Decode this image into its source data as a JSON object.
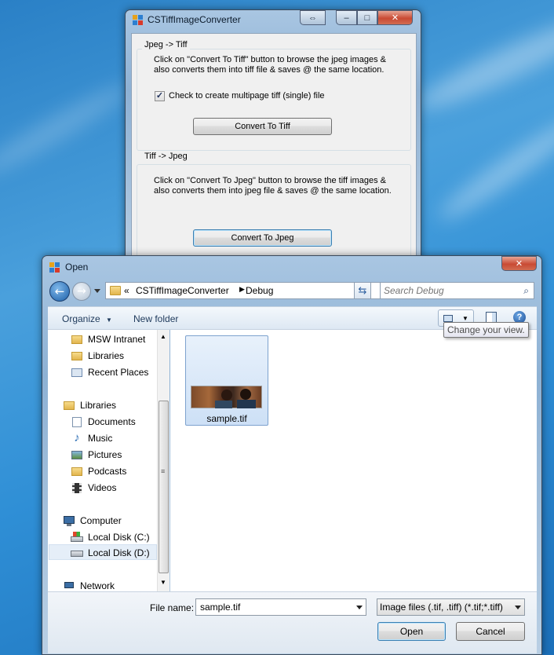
{
  "converter": {
    "title": "CSTiffImageConverter",
    "group1": {
      "label": "Jpeg -> Tiff",
      "desc_line1": "Click on \"Convert To Tiff\" button to browse the jpeg images &",
      "desc_line2": "also converts them into tiff file & saves @ the same location.",
      "checkbox_label": "Check to create multipage tiff (single) file",
      "checkbox_checked": true,
      "button": "Convert To Tiff"
    },
    "group2": {
      "label": "Tiff -> Jpeg",
      "desc_line1": "Click on \"Convert To Jpeg\" button to browse the tiff images &",
      "desc_line2": "also converts them into jpeg file & saves @ the same location.",
      "button": "Convert To Jpeg"
    },
    "title_buttons": {
      "swap": "⇔",
      "minimize": "–",
      "maximize": "□",
      "close": "✕"
    }
  },
  "open_dialog": {
    "title": "Open",
    "breadcrumb": {
      "overflow": "«",
      "items": [
        "CSTiffImageConverter",
        "Debug"
      ]
    },
    "search_placeholder": "Search Debug",
    "toolbar": {
      "organize": "Organize",
      "new_folder": "New folder"
    },
    "tooltip": "Change your view.",
    "nav": {
      "favorites": [
        "MSW Intranet",
        "Libraries",
        "Recent Places"
      ],
      "libraries_header": "Libraries",
      "libraries": [
        "Documents",
        "Music",
        "Pictures",
        "Podcasts",
        "Videos"
      ],
      "computer_header": "Computer",
      "drives": [
        "Local Disk (C:)",
        "Local Disk (D:)"
      ],
      "selected_drive": "Local Disk (D:)",
      "network_header": "Network"
    },
    "files": [
      {
        "name": "sample.tif",
        "selected": true
      }
    ],
    "file_name_label": "File name:",
    "file_name_value": "sample.tif",
    "file_type": "Image files (.tif, .tiff) (*.tif;*.tiff)",
    "open_button": "Open",
    "cancel_button": "Cancel"
  }
}
